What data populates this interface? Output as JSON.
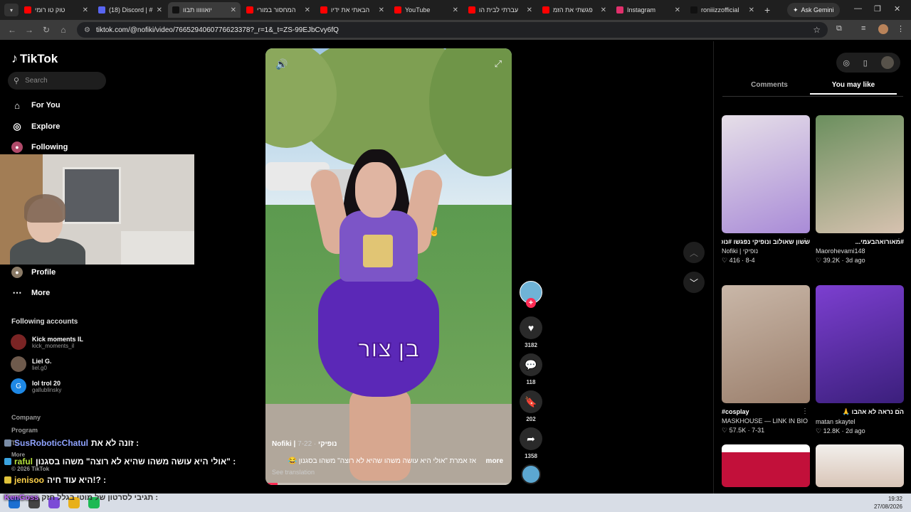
{
  "browser": {
    "tabs": [
      {
        "title": "טוק טו רומי",
        "fav_color": "#ff0000"
      },
      {
        "title": "(18) Discord | #",
        "fav_color": "#5865f2"
      },
      {
        "title": "יואווווו תבוו",
        "fav_color": "#111111",
        "active": true
      },
      {
        "title": "המחסור במורי",
        "fav_color": "#ff0000"
      },
      {
        "title": "הבאתי את ידיו",
        "fav_color": "#ff0000"
      },
      {
        "title": "YouTube",
        "fav_color": "#ff0000"
      },
      {
        "title": "עברתי לבית הו",
        "fav_color": "#ff0000"
      },
      {
        "title": "פגשתי את הזמ",
        "fav_color": "#ff0000"
      },
      {
        "title": "Instagram",
        "fav_color": "#e1306c"
      },
      {
        "title": "roniiizzofficial",
        "fav_color": "#111111"
      }
    ],
    "ask_gemini": "Ask Gemini",
    "url": "tiktok.com/@nofiki/video/7665294060776623378?_r=1&_t=ZS-99EJbCvy6fQ"
  },
  "sidebar": {
    "logo": "TikTok",
    "search_placeholder": "Search",
    "nav": [
      {
        "label": "For You",
        "icon": "home-icon"
      },
      {
        "label": "Explore",
        "icon": "compass-icon"
      },
      {
        "label": "Following",
        "icon": "following-icon"
      },
      {
        "label": "Profile",
        "icon": "profile-icon"
      },
      {
        "label": "More",
        "icon": "more-icon"
      }
    ],
    "following_header": "Following accounts",
    "accounts": [
      {
        "name": "Kick moments IL",
        "handle": "kick_moments_il"
      },
      {
        "name": "Liel G.",
        "handle": "liel.g0"
      },
      {
        "name": "lol trol 20",
        "handle": "gallublinsky"
      }
    ],
    "footer": [
      "Company",
      "Program",
      "Te",
      "More",
      "© 2026 TikTok"
    ]
  },
  "video": {
    "caption_overlay": "בן צור",
    "author": "Nofiki | נופיקי",
    "date": "· 7-22",
    "description": "אז אמרת \"אולי היא עושה משהו שהיא לא רוצה\" משהו בסגנון 😂",
    "more": "more",
    "see_translation": "See translation",
    "progress": 0.05
  },
  "actions": {
    "likes": "3182",
    "comments": "118",
    "saves": "202",
    "shares": "1358"
  },
  "right_panel": {
    "tabs": [
      "Comments",
      "You may like"
    ],
    "active_tab": "You may like",
    "cards": [
      {
        "title": "ששון שאולוב ונופיקי נפגשו #נופיקי #כוכבתהילדים",
        "author": "Nofiki | נופיקי",
        "likes": "416",
        "date": "8-4",
        "c1": "#a98bd7",
        "c2": "#e6dfe8"
      },
      {
        "title": "#מאורואהבעמי...",
        "author": "Maorohevami148",
        "likes": "39.2K",
        "date": "3d ago",
        "c1": "#d7c2b0",
        "c2": "#6b8f5e"
      },
      {
        "title": "#cosplay",
        "author": "MASKHOUSE — LINK IN BIO",
        "likes": "57.5K",
        "date": "7-31",
        "c1": "#9b7f6c",
        "c2": "#c9b7a8"
      },
      {
        "title": "הם נראה לא אהבו 🙏",
        "author": "matan skaytel",
        "likes": "12.8K",
        "date": "2d ago",
        "c1": "#3b1f7c",
        "c2": "#7c3fd0"
      }
    ]
  },
  "chat": [
    {
      "user": "SusRoboticChatul",
      "msg": ": זונה לא את"
    },
    {
      "user": "raful",
      "msg": ": \"אולי היא עושה משהו שהיא לא רוצה\" משהו בסגנון"
    },
    {
      "user": "jenisoo",
      "msg": ": ?!היא עוד חיה"
    },
    {
      "user": "KenGoss",
      "msg": ": תגיבי לסרטון של מוטי בגלל חזק"
    }
  ],
  "taskbar": {
    "time": "19:32",
    "date": "27/08/2026"
  },
  "colors": {
    "accent": "#fe2c55",
    "background": "#000000"
  }
}
